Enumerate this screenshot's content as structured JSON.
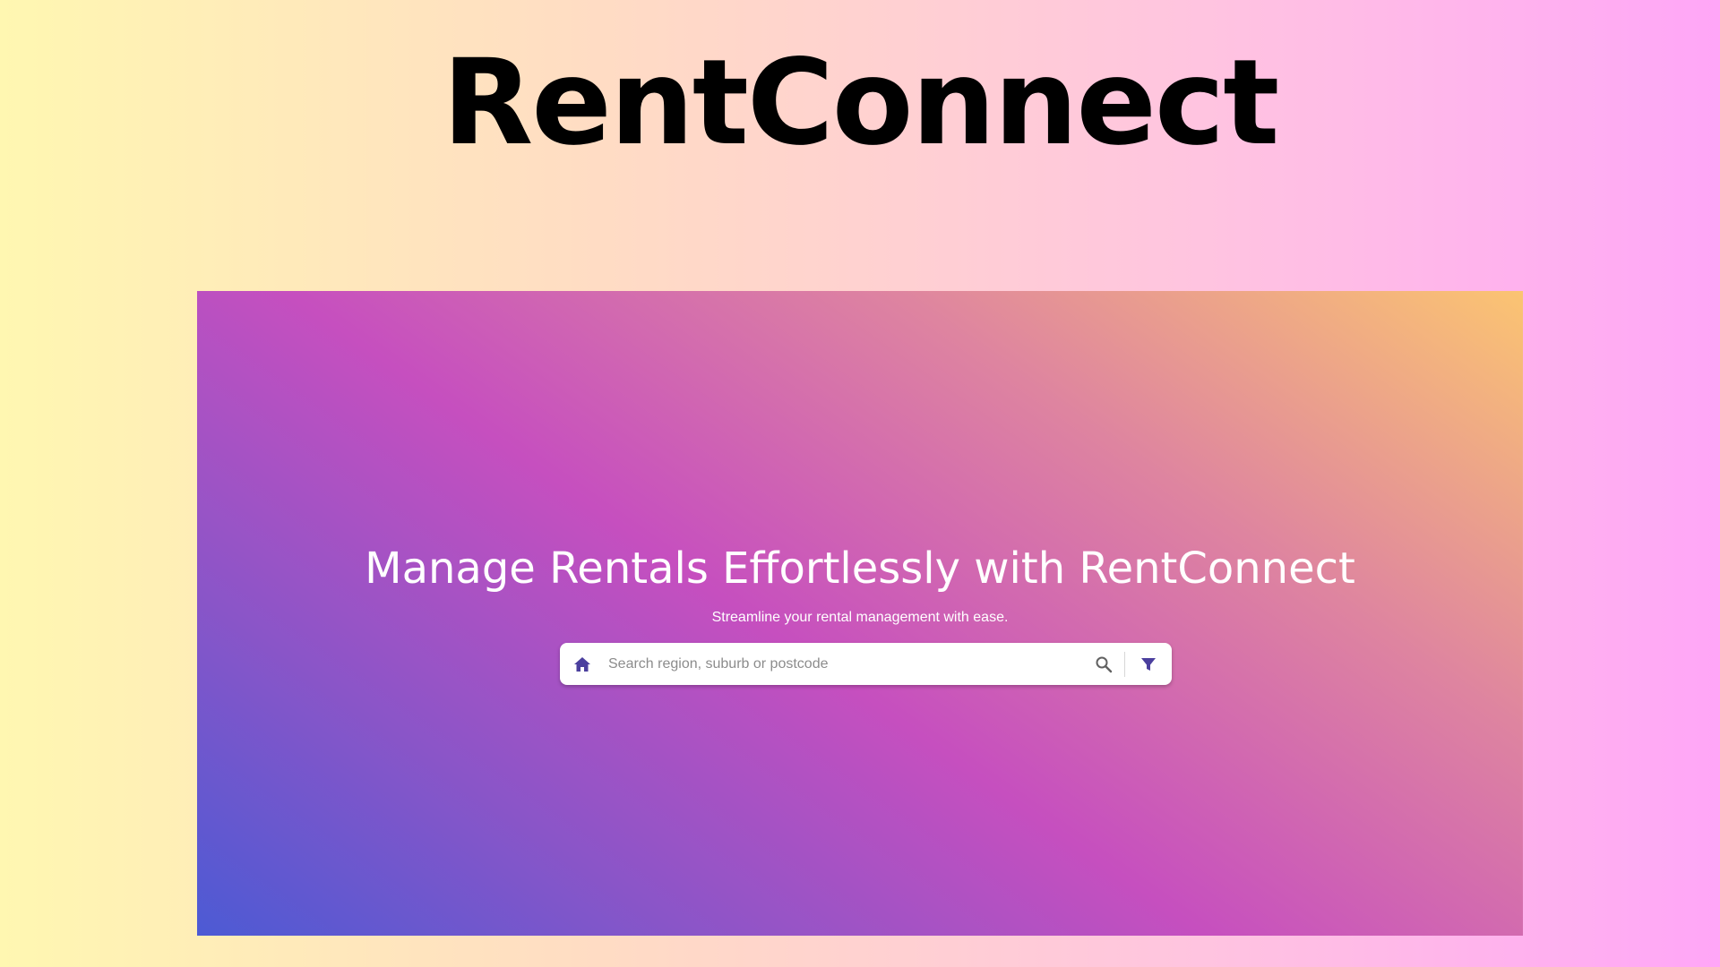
{
  "brand": {
    "title": "RentConnect"
  },
  "hero": {
    "heading": "Manage Rentals Effortlessly with RentConnect",
    "subheading": "Streamline your rental management with ease."
  },
  "search": {
    "placeholder": "Search region, suburb or postcode",
    "value": "",
    "home_icon": "home-icon",
    "search_icon": "magnifier-icon",
    "filter_icon": "funnel-icon"
  },
  "colors": {
    "icon_accent": "#4b3f9e",
    "search_icon": "#616161"
  }
}
